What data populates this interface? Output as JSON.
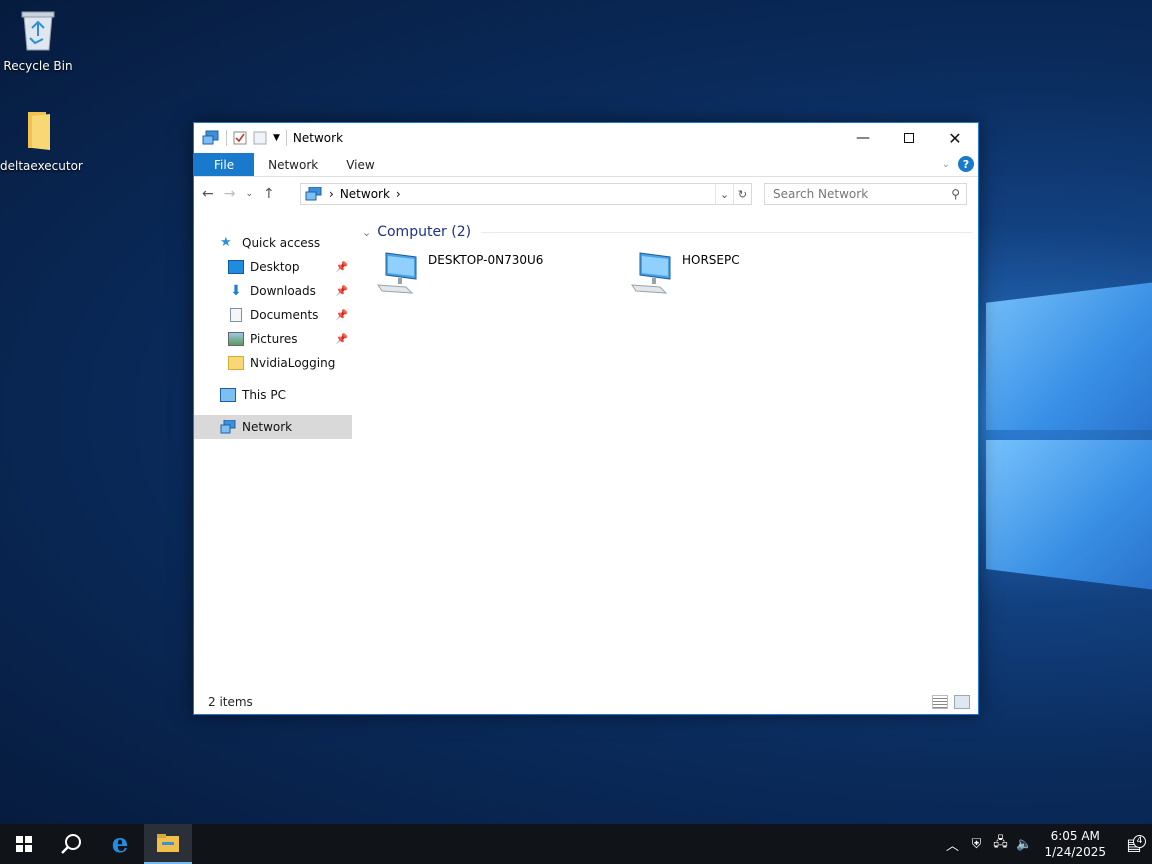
{
  "desktop": {
    "icons": [
      {
        "label": "Recycle Bin"
      },
      {
        "label": "deltaexecutor"
      }
    ]
  },
  "window": {
    "title": "Network",
    "ribbon": {
      "tabs": [
        "File",
        "Network",
        "View"
      ]
    },
    "address": {
      "crumb": "Network"
    },
    "search": {
      "placeholder": "Search Network"
    },
    "nav": {
      "quick_access": "Quick access",
      "items": [
        {
          "label": "Desktop",
          "pinned": true
        },
        {
          "label": "Downloads",
          "pinned": true
        },
        {
          "label": "Documents",
          "pinned": true
        },
        {
          "label": "Pictures",
          "pinned": true
        },
        {
          "label": "NvidiaLogging",
          "pinned": false
        }
      ],
      "this_pc": "This PC",
      "network": "Network"
    },
    "content": {
      "group_header": "Computer (2)",
      "computers": [
        {
          "name": "DESKTOP-0N730U6"
        },
        {
          "name": "HORSEPC"
        }
      ]
    },
    "status": {
      "count": "2 items"
    }
  },
  "taskbar": {
    "time": "6:05 AM",
    "date": "1/24/2025",
    "notification_count": "4"
  },
  "colors": {
    "accent": "#1979ca",
    "taskbar": "#101318",
    "group_header": "#1e3287"
  }
}
